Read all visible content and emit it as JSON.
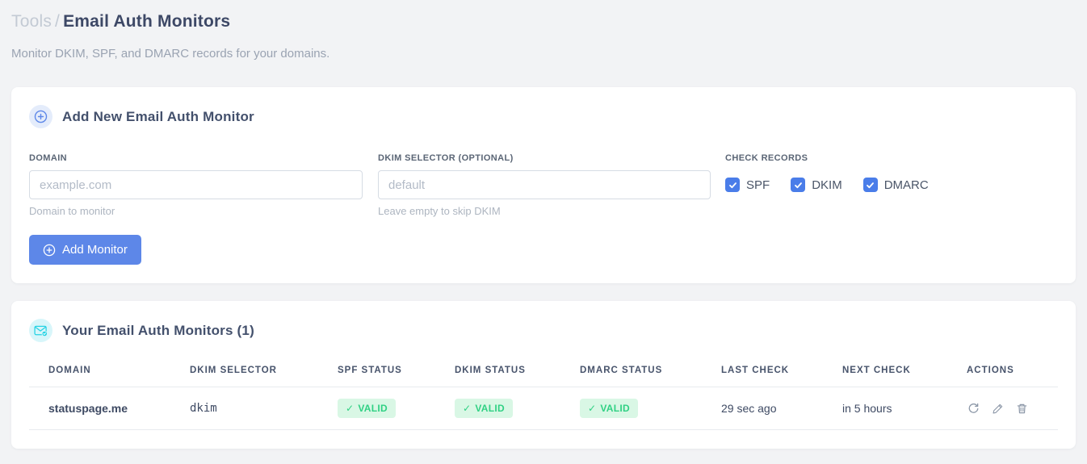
{
  "page": {
    "breadcrumb_parent": "Tools",
    "breadcrumb_separator": "/",
    "title": "Email Auth Monitors",
    "subtitle": "Monitor DKIM, SPF, and DMARC records for your domains."
  },
  "icons": {
    "check": "✓"
  },
  "colors": {
    "accent_blue": "#5d87e8",
    "checkbox_blue": "#4a7de9",
    "badge_green_bg": "#d9f7e5",
    "badge_green_text": "#30d184",
    "code_pink": "#ed4f9d",
    "cyan_icon": "#25d2e4",
    "page_background": "#f2f3f5"
  },
  "add_monitor_card": {
    "title": "Add New Email Auth Monitor",
    "domain_field": {
      "label": "DOMAIN",
      "placeholder": "example.com",
      "value": "",
      "helper": "Domain to monitor"
    },
    "dkim_field": {
      "label": "DKIM SELECTOR (OPTIONAL)",
      "placeholder": "default",
      "value": "",
      "helper": "Leave empty to skip DKIM"
    },
    "check_records": {
      "label": "CHECK RECORDS",
      "options": [
        {
          "label": "SPF",
          "checked": true
        },
        {
          "label": "DKIM",
          "checked": true
        },
        {
          "label": "DMARC",
          "checked": true
        }
      ]
    },
    "submit_label": "Add Monitor"
  },
  "monitors_card": {
    "title": "Your Email Auth Monitors (1)",
    "table": {
      "headers": [
        "DOMAIN",
        "DKIM SELECTOR",
        "SPF STATUS",
        "DKIM STATUS",
        "DMARC STATUS",
        "LAST CHECK",
        "NEXT CHECK",
        "ACTIONS"
      ],
      "rows": [
        {
          "domain": "statuspage.me",
          "dkim_selector": "dkim",
          "spf_status": "VALID",
          "dkim_status": "VALID",
          "dmarc_status": "VALID",
          "last_check": "29 sec ago",
          "next_check": "in 5 hours"
        }
      ]
    }
  }
}
